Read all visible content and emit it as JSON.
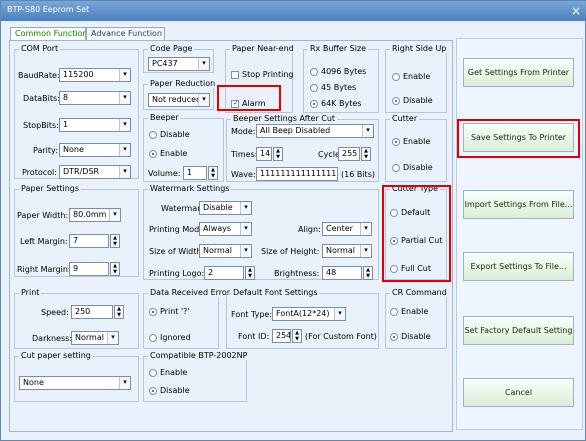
{
  "window": {
    "title": "BTP-S80 Eeprom Set",
    "close_icon": "×"
  },
  "tabs": [
    "Common Function",
    "Advance Function"
  ],
  "groups": {
    "com_port": "COM Port",
    "code_page": "Code Page",
    "paper_near_end": "Paper Near-end",
    "rx_buffer": "Rx Buffer Size",
    "right_side_up": "Right Side Up",
    "paper_reduction": "Paper Reduction",
    "beeper": "Beeper",
    "beeper_after_cut": "Beeper Settings After Cut",
    "cutter": "Cutter",
    "paper_settings": "Paper Settings",
    "watermark": "Watermark Settings",
    "cutter_type": "Cutter Type",
    "print": "Print",
    "data_error": "Data Received Error",
    "default_font": "Default Font Settings",
    "cr_command": "CR Command",
    "cut_paper": "Cut paper setting",
    "compat": "Compatible BTP-2002NP"
  },
  "labels": {
    "baudrate": "BaudRate:",
    "databits": "DataBits:",
    "stopbits": "StopBits:",
    "parity": "Parity:",
    "protocol": "Protocol:",
    "mode": "Mode:",
    "times": "Times:",
    "cycle": "Cycle:",
    "wave": "Wave:",
    "wave_bits": "(16 Bits)",
    "paper_width": "Paper Width:",
    "left_margin": "Left Margin:",
    "right_margin": "Right Margin:",
    "watermark": "Watermark:",
    "printing_mode": "Printing Mode:",
    "align": "Align:",
    "size_width": "Size of Width:",
    "size_height": "Size of Height:",
    "printing_logo": "Printing Logo:",
    "brightness": "Brightness:",
    "speed": "Speed:",
    "darkness": "Darkness:",
    "font_type": "Font Type:",
    "font_id": "Font ID:",
    "custom_font": "(For Custom Font)",
    "volume": "Volume:"
  },
  "values": {
    "baudrate": "115200",
    "databits": "8",
    "stopbits": "1",
    "parity": "None",
    "protocol": "DTR/DSR",
    "code_page": "PC437",
    "paper_reduction": "Not reduced",
    "mode": "All Beep Disabled",
    "times": "14",
    "cycle": "255",
    "wave": "1111111111111111",
    "volume": "1",
    "paper_width": "80.0mm",
    "left_margin": "7",
    "right_margin": "9",
    "watermark": "Disable",
    "printing_mode": "Always",
    "align": "Center",
    "size_width": "Normal",
    "size_height": "Normal",
    "printing_logo": "2",
    "brightness": "48",
    "speed": "250",
    "darkness": "Normal",
    "font_type": "FontA(12*24)",
    "font_id": "254",
    "cut_paper": "None"
  },
  "options": {
    "stop_printing": "Stop Printing",
    "alarm": "Alarm",
    "rx_4096": "4096 Bytes",
    "rx_45": "45 Bytes",
    "rx_64k": "64K Bytes",
    "right_enable": "Enable",
    "right_disable": "Disable",
    "beeper_disable": "Disable",
    "beeper_enable": "Enable",
    "cutter_enable": "Enable",
    "cutter_disable": "Disable",
    "ct_default": "Default",
    "ct_partial": "Partial Cut",
    "ct_full": "Full Cut",
    "print_7": "Print '?'",
    "ignored": "Ignored",
    "cr_enable": "Enable",
    "cr_disable": "Disable",
    "compat_enable": "Enable",
    "compat_disable": "Disable"
  },
  "buttons": [
    "Get Settings From Printer",
    "Save Settings To Printer",
    "Import Settings From File...",
    "Export Settings To File...",
    "Set Factory Default Setting",
    "Cancel"
  ]
}
